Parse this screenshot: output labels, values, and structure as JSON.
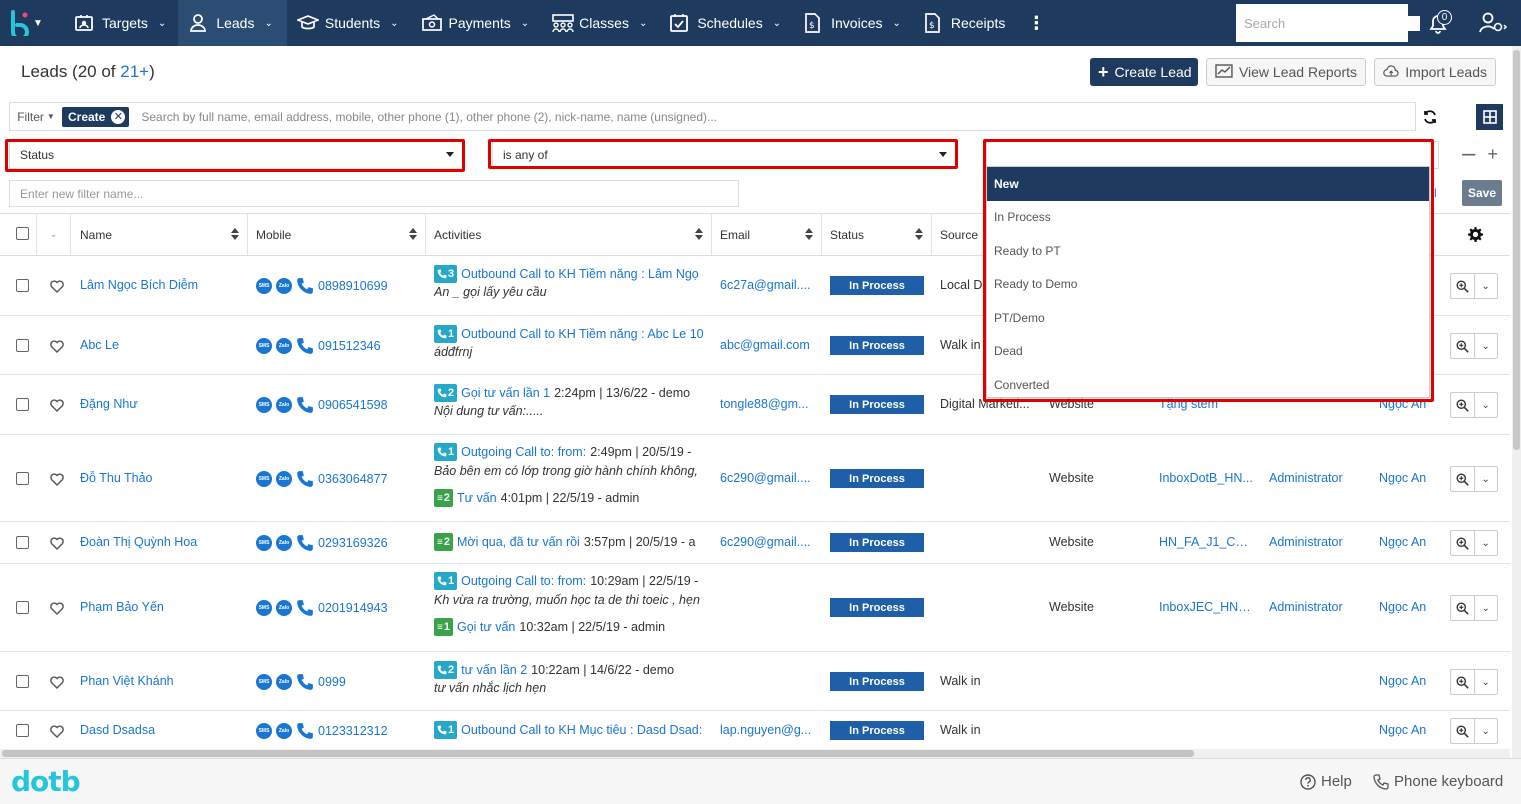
{
  "nav": {
    "items": [
      {
        "label": "Targets",
        "icon": "targets-icon",
        "caret": true
      },
      {
        "label": "Leads",
        "icon": "leads-icon",
        "caret": true,
        "active": true
      },
      {
        "label": "Students",
        "icon": "students-icon",
        "caret": true
      },
      {
        "label": "Payments",
        "icon": "payments-icon",
        "caret": true
      },
      {
        "label": "Classes",
        "icon": "classes-icon",
        "caret": true
      },
      {
        "label": "Schedules",
        "icon": "schedules-icon",
        "caret": true
      },
      {
        "label": "Invoices",
        "icon": "invoices-icon",
        "caret": true
      },
      {
        "label": "Receipts",
        "icon": "receipts-icon",
        "caret": false
      }
    ],
    "search_placeholder": "Search",
    "notification_count": "0"
  },
  "header": {
    "title_prefix": "Leads (20 of ",
    "title_count": "21+",
    "title_suffix": ")",
    "create_label": "Create Lead",
    "report_label": "View Lead Reports",
    "import_label": "Import Leads"
  },
  "filter": {
    "dropdown_label": "Filter",
    "chip_label": "Create",
    "search_placeholder": "Search by full name, email address, mobile, other phone (1), other phone (2), nick-name, name (unsigned)...",
    "field": "Status",
    "operator": "is any of",
    "value": "",
    "name_placeholder": "Enter new filter name...",
    "save_label": "Save"
  },
  "columns": {
    "name": "Name",
    "mobile": "Mobile",
    "activities": "Activities",
    "email": "Email",
    "status": "Status",
    "source": "Source"
  },
  "status_options": [
    "New",
    "In Process",
    "Ready to PT",
    "Ready to Demo",
    "PT/Demo",
    "Dead",
    "Converted"
  ],
  "rows": [
    {
      "name": "Lâm Ngọc Bích Diễm",
      "mobile": "0898910699",
      "activities": [
        {
          "type": "call",
          "count": "3",
          "text": "Outbound Call to KH Tiềm năng : Lâm Ngọ",
          "suffix": ""
        }
      ],
      "desc": "An _ gọi lấy yêu cầu",
      "email": "6c27a@gmail....",
      "status": "In Process",
      "source": "Local D",
      "lead_source": "",
      "campaign": "",
      "creator": "",
      "assigned": ""
    },
    {
      "name": "Abc Le",
      "mobile": "091512346",
      "activities": [
        {
          "type": "call",
          "count": "1",
          "text": "Outbound Call to KH Tiềm năng : Abc Le 10",
          "suffix": ""
        }
      ],
      "desc": "ádđfrnj",
      "email": "abc@gmail.com",
      "status": "In Process",
      "source": "Walk in",
      "lead_source": "",
      "campaign": "",
      "creator": "",
      "assigned": ""
    },
    {
      "name": "Đặng Như",
      "mobile": "0906541598",
      "activities": [
        {
          "type": "call",
          "count": "2",
          "text": "Gọi tư vấn lần 1",
          "suffix": " 2:24pm | 13/6/22 - demo"
        }
      ],
      "desc": "Nội dung tư vấn:.....",
      "email": "tongle88@gm...",
      "status": "In Process",
      "source": "Digital Marketi...",
      "lead_source": "Website",
      "campaign": "Tặng stem",
      "creator": "",
      "assigned": "Ngọc An"
    },
    {
      "name": "Đỗ Thu Thảo",
      "mobile": "0363064877",
      "activities": [
        {
          "type": "call",
          "count": "1",
          "text": "Outgoing Call to: from:",
          "suffix": " 2:49pm | 20/5/19 - "
        },
        {
          "type": "task",
          "count": "2",
          "text": "Tư vấn",
          "suffix": " 4:01pm | 22/5/19 - admin"
        }
      ],
      "desc": "Bảo bên em có lớp trong giờ hành chính không,",
      "email": "6c290@gmail....",
      "status": "In Process",
      "source": "",
      "lead_source": "Website",
      "campaign": "InboxDotB_HN...",
      "creator": "Administrator",
      "assigned": "Ngọc An"
    },
    {
      "name": "Đoàn Thị Quỳnh Hoa",
      "mobile": "0293169326",
      "activities": [
        {
          "type": "task",
          "count": "2",
          "text": "Mời qua, đã tư vấn rồi",
          "suffix": " 3:57pm | 20/5/19 - a"
        }
      ],
      "desc": "",
      "email": "6c290@gmail....",
      "status": "In Process",
      "source": "",
      "lead_source": "Website",
      "campaign": "HN_FA_J1_CD_...",
      "creator": "Administrator",
      "assigned": "Ngọc An"
    },
    {
      "name": "Phạm Bảo Yến",
      "mobile": "0201914943",
      "activities": [
        {
          "type": "call",
          "count": "1",
          "text": "Outgoing Call to: from:",
          "suffix": " 10:29am | 22/5/19 - "
        },
        {
          "type": "task",
          "count": "1",
          "text": "Gọi tư vấn",
          "suffix": " 10:32am | 22/5/19 - admin"
        }
      ],
      "desc": "Kh vừa ra trường, muốn học ta de thi toeic , hẹn",
      "email": "",
      "status": "In Process",
      "source": "",
      "lead_source": "Website",
      "campaign": "InboxJEC_HN_...",
      "creator": "Administrator",
      "assigned": "Ngọc An"
    },
    {
      "name": "Phan Việt Khánh",
      "mobile": "0999",
      "activities": [
        {
          "type": "call",
          "count": "2",
          "text": "tư vấn lần 2",
          "suffix": " 10:22am | 14/6/22 - demo"
        }
      ],
      "desc": "tư vấn nhắc lịch hẹn",
      "email": "",
      "status": "In Process",
      "source": "Walk in",
      "lead_source": "",
      "campaign": "",
      "creator": "",
      "assigned": "Ngọc An"
    },
    {
      "name": "Dasd Dsadsa",
      "mobile": "0123312312",
      "activities": [
        {
          "type": "call",
          "count": "1",
          "text": "Outbound Call to KH Mục tiêu : Dasd Dsad:",
          "suffix": ""
        }
      ],
      "desc": "",
      "email": "lap.nguyen@g...",
      "status": "In Process",
      "source": "Walk in",
      "lead_source": "",
      "campaign": "",
      "creator": "",
      "assigned": "Ngọc An"
    }
  ],
  "footer": {
    "logo": "dotb",
    "help_label": "Help",
    "keyboard_label": "Phone keyboard"
  },
  "colors": {
    "nav_bg": "#1e3a5f",
    "link": "#1976d2",
    "status_pill": "#1e5fa8",
    "highlight_box": "#e00000",
    "brand": "#26c6da"
  }
}
